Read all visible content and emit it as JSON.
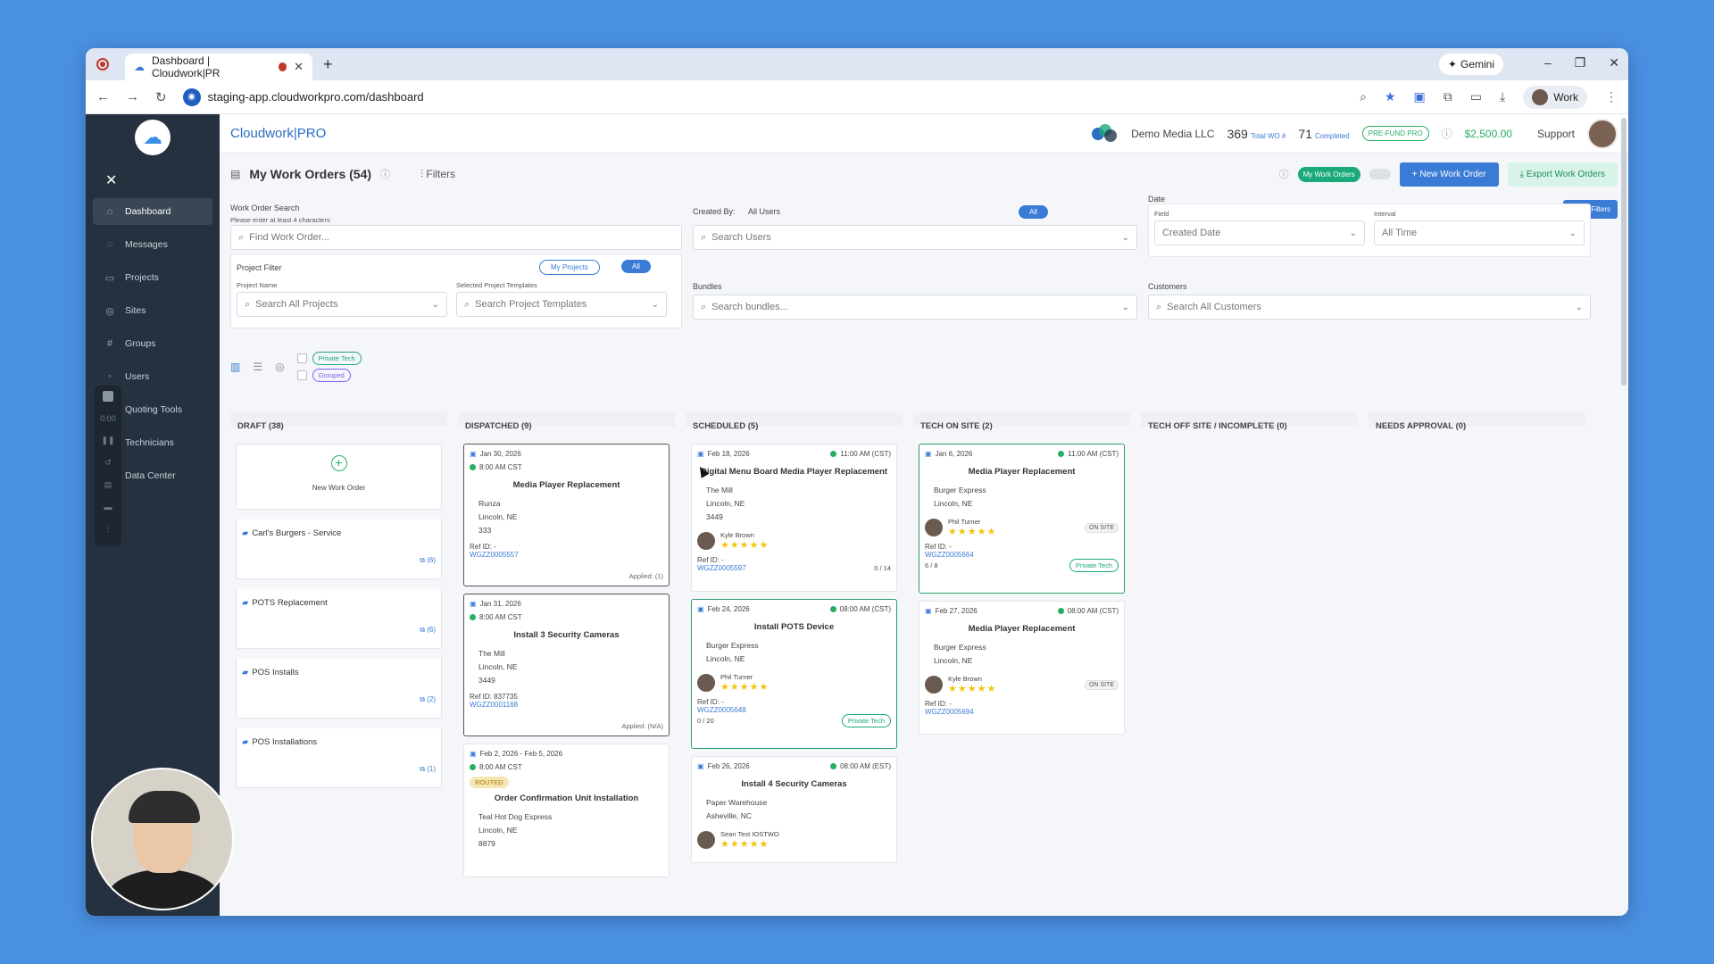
{
  "browser": {
    "tab_title": "Dashboard | Cloudwork|PR",
    "new_tab": "+",
    "gemini": "Gemini",
    "url": "staging-app.cloudworkpro.com/dashboard",
    "profile": "Work"
  },
  "sidebar": {
    "items": [
      {
        "label": "Dashboard",
        "icon": "home-icon"
      },
      {
        "label": "Messages",
        "icon": "chat-icon"
      },
      {
        "label": "Projects",
        "icon": "folder-icon"
      },
      {
        "label": "Sites",
        "icon": "pin-icon"
      },
      {
        "label": "Groups",
        "icon": "hash-icon"
      },
      {
        "label": "Users",
        "icon": "user-icon"
      },
      {
        "label": "Quoting Tools",
        "icon": "calculator-icon"
      },
      {
        "label": "Technicians",
        "icon": "wrench-icon"
      },
      {
        "label": "Data Center",
        "icon": "database-icon"
      }
    ],
    "recording_time": "0:00"
  },
  "topnav": {
    "brand": "Cloudwork|PRO",
    "company": "Demo Media LLC",
    "total_wo": "369",
    "total_wo_label": "Total WO #",
    "completed": "71",
    "completed_label": "Completed",
    "prefund": "PRE-FUND PRO",
    "balance": "$2,500.00",
    "support": "Support"
  },
  "header": {
    "title": "My Work Orders (54)",
    "filters": "Filters",
    "my_work_orders": "My Work Orders",
    "new_work_order": "New Work Order",
    "export": "Export Work Orders",
    "reset": "Reset Filters"
  },
  "filters": {
    "wo_search_label": "Work Order Search",
    "wo_search_hint": "Please enter at least 4 characters",
    "wo_search_placeholder": "Find Work Order...",
    "created_by_label": "Created By:",
    "created_by_value": "All Users",
    "created_by_all": "All",
    "search_users": "Search Users",
    "date_label": "Date",
    "field_label": "Field",
    "field_value": "Created Date",
    "interval_label": "Interval",
    "interval_value": "All Time",
    "project_filter": "Project Filter",
    "my_projects": "My Projects",
    "all": "All",
    "project_name_label": "Project Name",
    "project_name_placeholder": "Search All Projects",
    "templates_label": "Selected Project Templates",
    "templates_placeholder": "Search Project Templates",
    "bundles_label": "Bundles",
    "bundles_placeholder": "Search bundles...",
    "customers_label": "Customers",
    "customers_placeholder": "Search All Customers",
    "private_tech": "Private Tech",
    "grouped": "Grouped"
  },
  "board": {
    "draft": {
      "title": "DRAFT (38)",
      "new_label": "New Work Order",
      "projects": [
        {
          "name": "Carl's Burgers - Service",
          "count": "(6)"
        },
        {
          "name": "POTS Replacement",
          "count": "(6)"
        },
        {
          "name": "POS Installs",
          "count": "(2)"
        },
        {
          "name": "POS Installations",
          "count": "(1)"
        }
      ]
    },
    "dispatched": {
      "title": "DISPATCHED (9)",
      "cards": [
        {
          "date": "Jan 30, 2026",
          "time": "8:00 AM CST",
          "title": "Media Player Replacement",
          "site": "Runza",
          "city": "Lincoln, NE",
          "num": "333",
          "ref": "Ref ID: -",
          "refid": "WGZZ0005557",
          "applied": "Applied: (1)"
        },
        {
          "date": "Jan 31, 2026",
          "time": "8:00 AM CST",
          "title": "Install 3 Security Cameras",
          "site": "The Mill",
          "city": "Lincoln, NE",
          "num": "3449",
          "ref": "Ref ID: 837735",
          "refid": "WGZZ0001168",
          "applied": "Applied: (N/A)"
        },
        {
          "date": "Feb 2, 2026 - Feb 5, 2026",
          "time": "8:00 AM CST",
          "status": "ROUTED",
          "title": "Order Confirmation Unit Installation",
          "site": "Teal Hot Dog Express",
          "city": "Lincoln, NE",
          "num": "8879"
        }
      ]
    },
    "scheduled": {
      "title": "SCHEDULED (5)",
      "cards": [
        {
          "date": "Feb 18, 2026",
          "time": "11:00 AM (CST)",
          "title": "Digital Menu Board Media Player Replacement",
          "site": "The Mill",
          "city": "Lincoln, NE",
          "num": "3449",
          "tech": "Kyle Brown",
          "ref": "Ref ID: -",
          "refid": "WGZZ0005597",
          "progress": "0 / 14"
        },
        {
          "date": "Feb 24, 2026",
          "time": "08:00 AM (CST)",
          "title": "Install POTS Device",
          "site": "Burger Express",
          "city": "Lincoln, NE",
          "tech": "Phil Turner",
          "ref": "Ref ID: -",
          "refid": "WGZZ0005648",
          "progress": "0 / 20",
          "tag": "Private Tech"
        },
        {
          "date": "Feb 26, 2026",
          "time": "08:00 AM (EST)",
          "title": "Install 4 Security Cameras",
          "site": "Paper Warehouse",
          "city": "Asheville, NC",
          "tech": "Sean Test IOSTWO"
        }
      ]
    },
    "tech_on_site": {
      "title": "TECH ON SITE (2)",
      "cards": [
        {
          "date": "Jan 6, 2026",
          "time": "11:00 AM (CST)",
          "title": "Media Player Replacement",
          "site": "Burger Express",
          "city": "Lincoln, NE",
          "tech": "Phil Turner",
          "status": "ON SITE",
          "ref": "Ref ID: -",
          "refid": "WGZZ0005664",
          "progress": "6 / 8",
          "tag": "Private Tech"
        },
        {
          "date": "Feb 27, 2026",
          "time": "08:00 AM (CST)",
          "title": "Media Player Replacement",
          "site": "Burger Express",
          "city": "Lincoln, NE",
          "tech": "Kyle Brown",
          "status": "ON SITE",
          "ref": "Ref ID: -",
          "refid": "WGZZ0005694"
        }
      ]
    },
    "tech_off_site": {
      "title": "TECH OFF SITE / INCOMPLETE (0)"
    },
    "needs_approval": {
      "title": "NEEDS APPROVAL (0)"
    },
    "stars": "★★★★★"
  }
}
